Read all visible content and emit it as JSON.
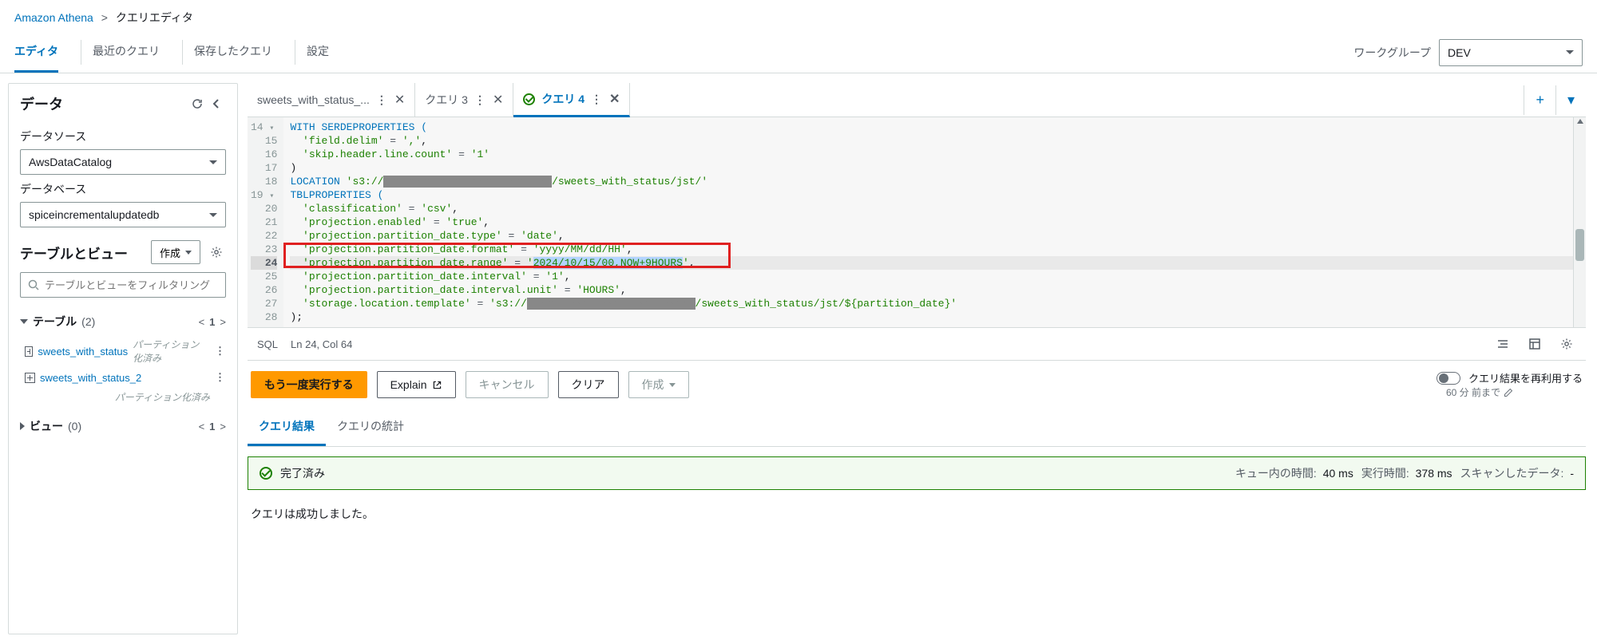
{
  "breadcrumb": {
    "root": "Amazon Athena",
    "current": "クエリエディタ"
  },
  "mainTabs": {
    "editor": "エディタ",
    "recent": "最近のクエリ",
    "saved": "保存したクエリ",
    "settings": "設定"
  },
  "workgroup": {
    "label": "ワークグループ",
    "value": "DEV"
  },
  "data": {
    "title": "データ",
    "dsLabel": "データソース",
    "dsValue": "AwsDataCatalog",
    "dbLabel": "データベース",
    "dbValue": "spiceincrementalupdatedb",
    "tvTitle": "テーブルとビュー",
    "createBtn": "作成",
    "searchPh": "テーブルとビューをフィルタリング",
    "tablesLabel": "テーブル",
    "tablesCount": "(2)",
    "pageNum": "1",
    "table1": "sweets_with_status",
    "table1meta": "パーティション化済み",
    "table2": "sweets_with_status_2",
    "table2meta": "パーティション化済み",
    "viewsLabel": "ビュー",
    "viewsCount": "(0)"
  },
  "qtabs": {
    "t1": "sweets_with_status_...",
    "t2": "クエリ 3",
    "t3": "クエリ 4"
  },
  "editor": {
    "lines": [
      14,
      15,
      16,
      17,
      18,
      19,
      20,
      21,
      22,
      23,
      24,
      25,
      26,
      27,
      28
    ],
    "hlLine": 24
  },
  "code": {
    "l14a": "WITH SERDEPROPERTIES (",
    "l15a": "  'field.delim'",
    "l15b": " = ",
    "l15c": "','",
    "l15d": ",",
    "l16a": "  'skip.header.line.count'",
    "l16b": " = ",
    "l16c": "'1'",
    "l17": ")",
    "l18a": "LOCATION ",
    "l18b": "'s3://",
    "l18r": "xxxxxxxxxxxxxxxxxxxxxxxxxxx",
    "l18c": "/sweets_with_status/jst/'",
    "l19": "TBLPROPERTIES (",
    "l20a": "  'classification'",
    "l20b": " = ",
    "l20c": "'csv'",
    "l20d": ",",
    "l21a": "  'projection.enabled'",
    "l21b": " = ",
    "l21c": "'true'",
    "l21d": ",",
    "l22a": "  'projection.partition_date.type'",
    "l22b": " = ",
    "l22c": "'date'",
    "l22d": ",",
    "l23a": "  'projection.partition_date.format'",
    "l23b": " = ",
    "l23c": "'yyyy/MM/dd/HH'",
    "l23d": ",",
    "l24a": "  'projection.partition_date.range'",
    "l24b": " = ",
    "l24c1": "'",
    "l24sel": "2024/10/15/00,NOW+9HOURS",
    "l24c2": "'",
    "l24d": ",",
    "l25a": "  'projection.partition_date.interval'",
    "l25b": " = ",
    "l25c": "'1'",
    "l25d": ",",
    "l26a": "  'projection.partition_date.interval.unit'",
    "l26b": " = ",
    "l26c": "'HOURS'",
    "l26d": ",",
    "l27a": "  'storage.location.template'",
    "l27b": " = ",
    "l27c1": "'s3://",
    "l27r": "xxxxxxxxxxxxxxxxxxxxxxxxxxx",
    "l27c2": "/sweets_with_status/jst/${partition_date}'",
    "l28": ");"
  },
  "status": {
    "lang": "SQL",
    "pos": "Ln 24, Col 64"
  },
  "actions": {
    "run": "もう一度実行する",
    "explain": "Explain",
    "cancel": "キャンセル",
    "clear": "クリア",
    "create": "作成",
    "reuse": "クエリ結果を再利用する",
    "reuseSub": "60 分 前まで"
  },
  "resultTabs": {
    "results": "クエリ結果",
    "stats": "クエリの統計"
  },
  "banner": {
    "status": "完了済み",
    "queueLabel": "キュー内の時間:",
    "queueVal": "40 ms",
    "runLabel": "実行時間:",
    "runVal": "378 ms",
    "scanLabel": "スキャンしたデータ:",
    "scanVal": "-"
  },
  "resultMsg": "クエリは成功しました。"
}
